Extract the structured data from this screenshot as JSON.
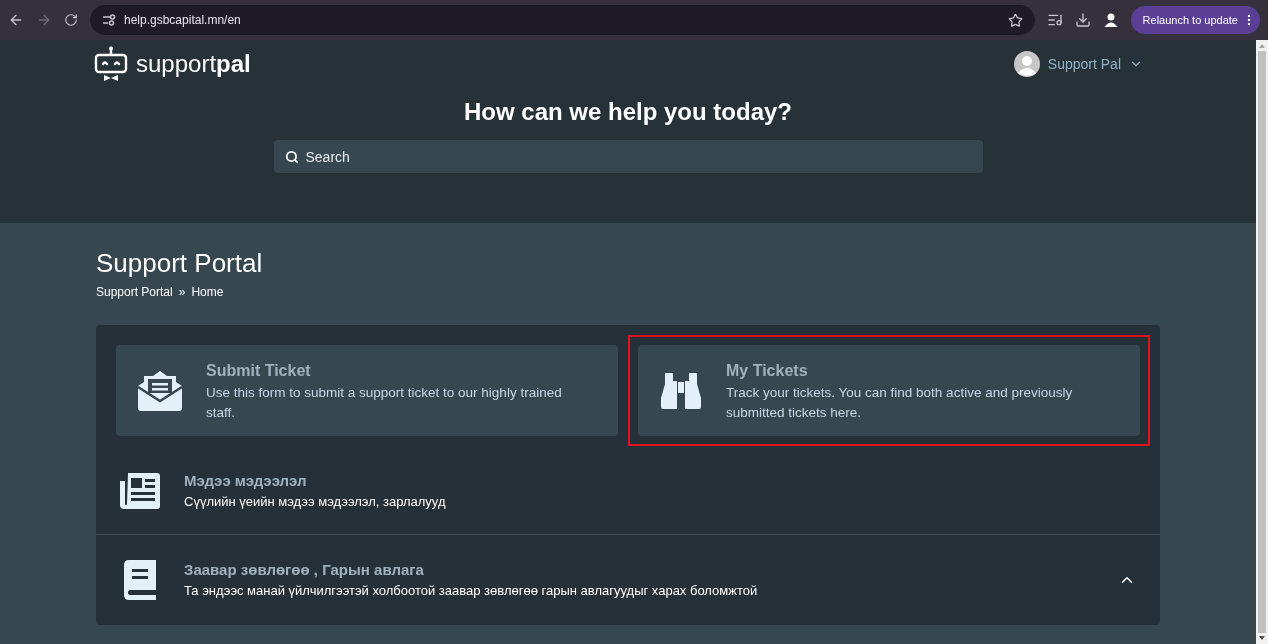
{
  "browser": {
    "url": "help.gsbcapital.mn/en",
    "update_button": "Relaunch to update"
  },
  "header": {
    "logo_text": "support",
    "logo_bold": "pal",
    "user": "Support Pal",
    "title": "How can we help you today?",
    "search": {
      "placeholder": "Search"
    }
  },
  "page": {
    "title": "Support Portal",
    "breadcrumb": [
      "Support Portal",
      "Home"
    ],
    "breadcrumb_separator": "»"
  },
  "cards": [
    {
      "kind": "envelope",
      "title": "Submit Ticket",
      "description": "Use this form to submit a support ticket to our highly trained staff.",
      "highlighted": false
    },
    {
      "kind": "binoculars",
      "title": "My Tickets",
      "description": "Track your tickets. You can find both active and previously submitted tickets here.",
      "highlighted": true
    }
  ],
  "categories": [
    {
      "kind": "news",
      "title": "Мэдээ мэдээлэл",
      "description": "Сүүлийн үеийн мэдээ мэдээлэл, зарлалууд"
    },
    {
      "kind": "book",
      "title": "Заавар зөвлөгөө , Гарын авлага",
      "description": "Та эндээс манай үйлчилгээтэй холбоотой заавар зөвлөгөө гарын авлагуудыг харах боломжтой",
      "expanded": true
    }
  ]
}
